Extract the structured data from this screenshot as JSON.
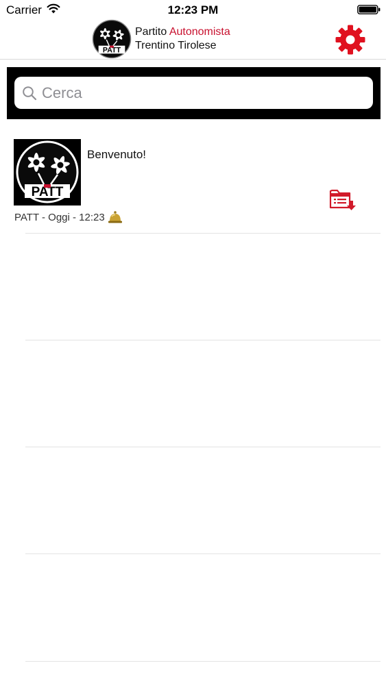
{
  "status_bar": {
    "carrier": "Carrier",
    "time": "12:23 PM"
  },
  "header": {
    "logo_text": "PATT",
    "title_line1_part1": "Partito",
    "title_line1_part2": "Autonomista",
    "title_line2": "Trentino Tirolese",
    "accent_color": "#c8102e"
  },
  "search": {
    "placeholder": "Cerca",
    "value": ""
  },
  "news": {
    "items": [
      {
        "thumb_logo": "PATT",
        "title": "Benvenuto!",
        "meta": "PATT - Oggi - 12:23",
        "icon": "bell-icon",
        "action_icon": "pdf-download-icon"
      }
    ]
  }
}
